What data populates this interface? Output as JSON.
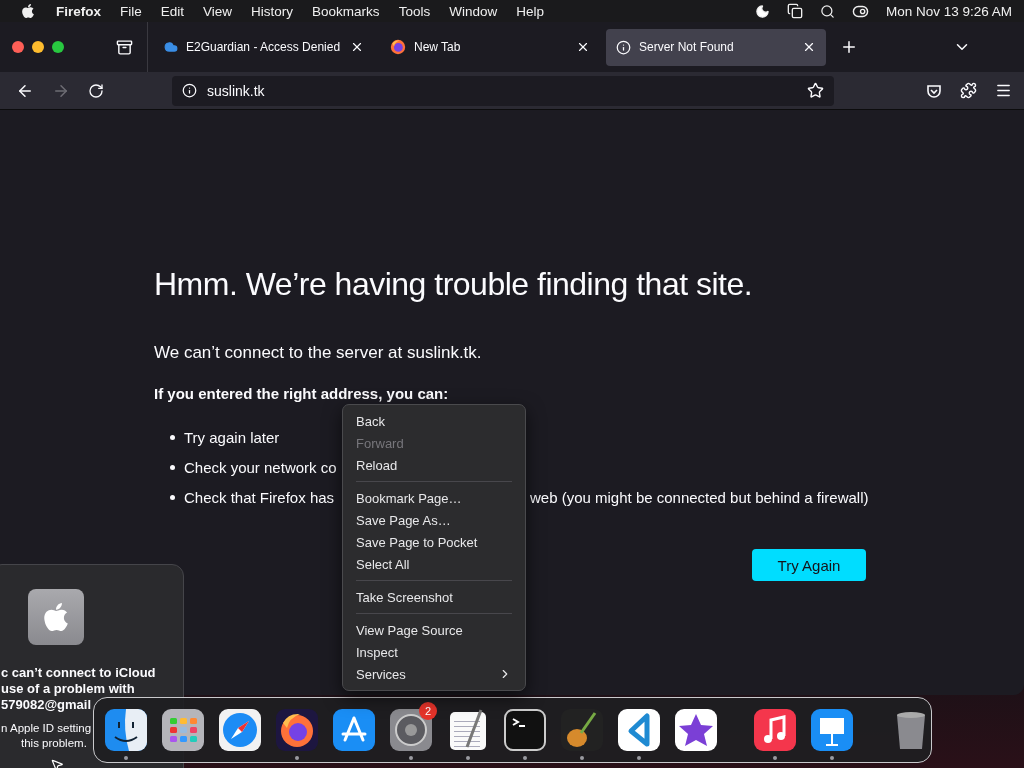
{
  "menu_bar": {
    "app": "Firefox",
    "items": [
      "File",
      "Edit",
      "View",
      "History",
      "Bookmarks",
      "Tools",
      "Window",
      "Help"
    ],
    "clock": "Mon Nov 13  9:26 AM"
  },
  "tabs": [
    {
      "label": "E2Guardian - Access Denied",
      "selected": false,
      "kind": "cloud"
    },
    {
      "label": "New Tab",
      "selected": false,
      "kind": "firefox"
    },
    {
      "label": "Server Not Found",
      "selected": true,
      "kind": "info"
    }
  ],
  "nav": {
    "back_disabled": false,
    "forward_disabled": true,
    "url": "suslink.tk"
  },
  "page": {
    "title": "Hmm. We’re having trouble finding that site.",
    "message": "We can’t connect to the server at suslink.tk.",
    "hint": "If you entered the right address, you can:",
    "bullets": [
      {
        "parts": [
          "Try again later"
        ]
      },
      {
        "parts": [
          "Check your network co"
        ]
      },
      {
        "parts": [
          "Check that Firefox has",
          "web (you might be connected but behind a firewall)"
        ]
      }
    ],
    "button": "Try Again"
  },
  "context_menu": {
    "groups": [
      [
        {
          "label": "Back",
          "disabled": false,
          "submenu": false
        },
        {
          "label": "Forward",
          "disabled": true,
          "submenu": false
        },
        {
          "label": "Reload",
          "disabled": false,
          "submenu": false
        }
      ],
      [
        {
          "label": "Bookmark Page…",
          "disabled": false,
          "submenu": false
        },
        {
          "label": "Save Page As…",
          "disabled": false,
          "submenu": false
        },
        {
          "label": "Save Page to Pocket",
          "disabled": false,
          "submenu": false
        },
        {
          "label": "Select All",
          "disabled": false,
          "submenu": false
        }
      ],
      [
        {
          "label": "Take Screenshot",
          "disabled": false,
          "submenu": false
        }
      ],
      [
        {
          "label": "View Page Source",
          "disabled": false,
          "submenu": false
        },
        {
          "label": "Inspect",
          "disabled": false,
          "submenu": false
        },
        {
          "label": "Services",
          "disabled": false,
          "submenu": true
        }
      ]
    ]
  },
  "notification": {
    "lines": [
      "c can’t connect to iCloud",
      "use of a problem with",
      "579082@gmail"
    ],
    "body": [
      "n Apple ID setting",
      "this problem."
    ]
  },
  "dock": {
    "groups": [
      [
        {
          "kind": "finder",
          "running": true
        },
        {
          "kind": "launchpad",
          "running": false
        },
        {
          "kind": "safari",
          "running": false
        },
        {
          "kind": "firefox",
          "running": true
        },
        {
          "kind": "appstore",
          "running": false
        },
        {
          "kind": "settings",
          "running": true,
          "badge": "2"
        },
        {
          "kind": "textedit",
          "running": true
        },
        {
          "kind": "terminal",
          "running": true
        },
        {
          "kind": "garageband",
          "running": true
        },
        {
          "kind": "vscode",
          "running": true
        },
        {
          "kind": "imovie",
          "running": false
        }
      ],
      [
        {
          "kind": "music",
          "running": true
        },
        {
          "kind": "keynote",
          "running": true
        }
      ],
      [
        {
          "kind": "trash",
          "running": false
        }
      ]
    ]
  }
}
